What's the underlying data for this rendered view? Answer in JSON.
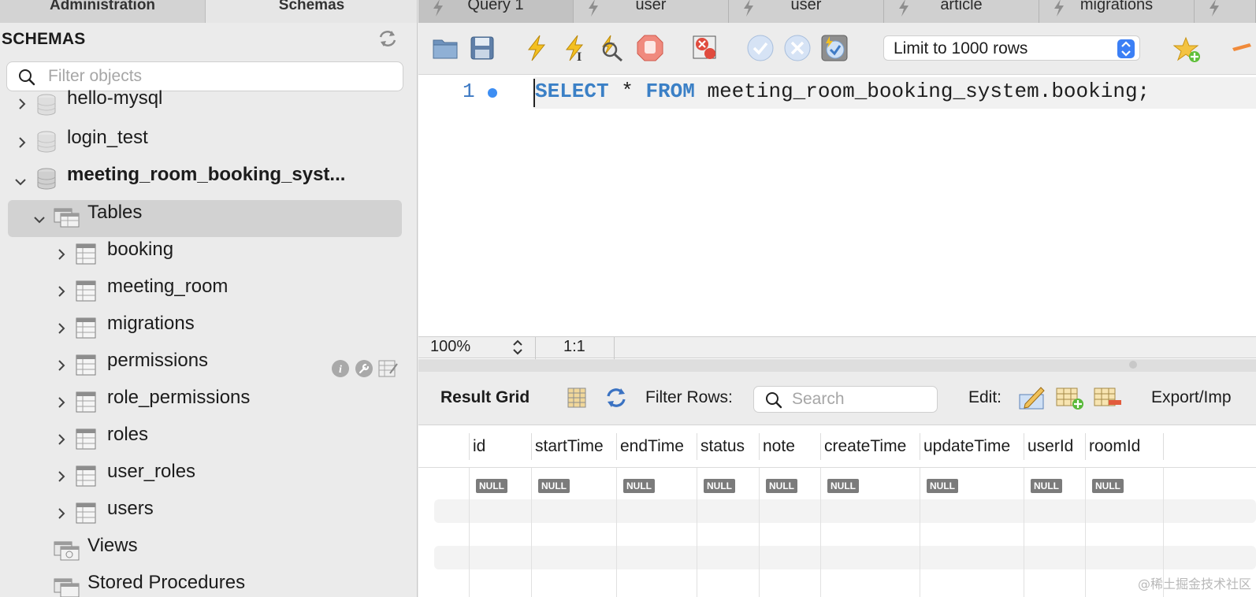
{
  "left_panel": {
    "nav_tabs": [
      "Administration",
      "Schemas"
    ],
    "title": "SCHEMAS",
    "filter_placeholder": "Filter objects",
    "tree": [
      {
        "label": "hello-mysql",
        "type": "schema",
        "expanded": false
      },
      {
        "label": "login_test",
        "type": "schema",
        "expanded": false
      },
      {
        "label": "meeting_room_booking_syst...",
        "type": "schema",
        "expanded": true
      },
      {
        "label": "Tables",
        "type": "folder",
        "expanded": true,
        "selected": true
      },
      {
        "label": "booking",
        "type": "table"
      },
      {
        "label": "meeting_room",
        "type": "table"
      },
      {
        "label": "migrations",
        "type": "table"
      },
      {
        "label": "permissions",
        "type": "table"
      },
      {
        "label": "role_permissions",
        "type": "table"
      },
      {
        "label": "roles",
        "type": "table"
      },
      {
        "label": "user_roles",
        "type": "table"
      },
      {
        "label": "users",
        "type": "table"
      },
      {
        "label": "Views",
        "type": "folder"
      },
      {
        "label": "Stored Procedures",
        "type": "folder"
      }
    ]
  },
  "query_tabs": [
    "Query 1",
    "user",
    "user",
    "article",
    "migrations",
    ""
  ],
  "toolbar": {
    "limit_value": "Limit to 1000 rows"
  },
  "editor": {
    "line_number": "1",
    "query_keyword_1": "SELECT",
    "query_middle": " * ",
    "query_keyword_2": "FROM",
    "query_rest": " meeting_room_booking_system.booking;"
  },
  "status_bar": {
    "zoom": "100%",
    "position": "1:1"
  },
  "result_bar": {
    "title": "Result Grid",
    "filter_label": "Filter Rows:",
    "search_placeholder": "Search",
    "edit_label": "Edit:",
    "export_label": "Export/Imp"
  },
  "grid": {
    "columns": [
      "id",
      "startTime",
      "endTime",
      "status",
      "note",
      "createTime",
      "updateTime",
      "userId",
      "roomId"
    ],
    "row": [
      "NULL",
      "NULL",
      "NULL",
      "NULL",
      "NULL",
      "NULL",
      "NULL",
      "NULL",
      "NULL"
    ]
  },
  "watermark": "@稀土掘金技术社区",
  "colors": {
    "keyword": "#3b80c6",
    "selection": "#d2d2d2",
    "accent": "#3b7ff5"
  }
}
